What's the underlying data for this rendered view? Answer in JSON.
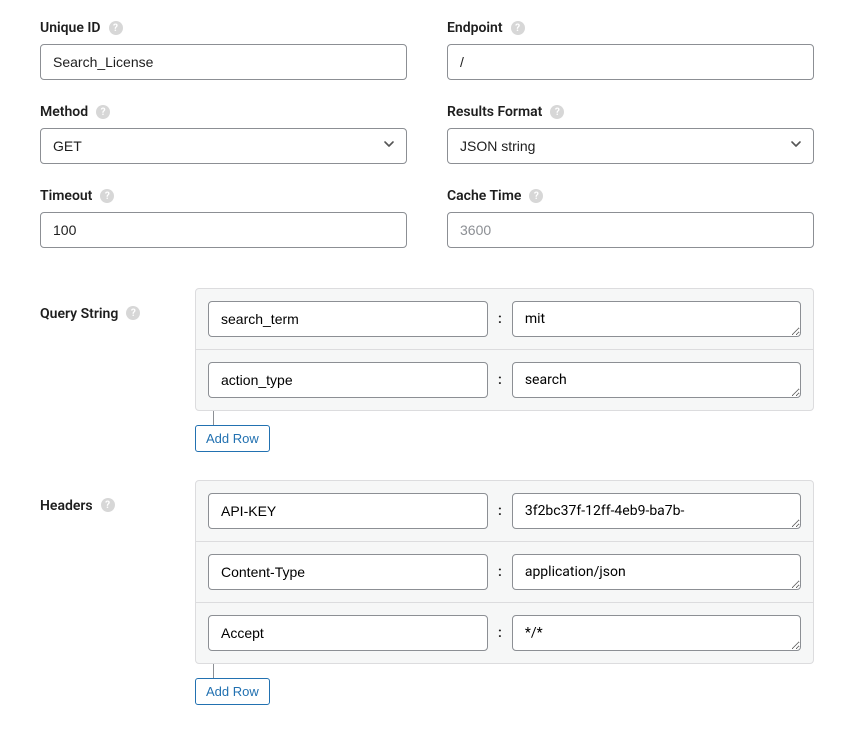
{
  "fields": {
    "unique_id": {
      "label": "Unique ID",
      "value": "Search_License"
    },
    "endpoint": {
      "label": "Endpoint",
      "value": "/"
    },
    "method": {
      "label": "Method",
      "value": "GET"
    },
    "results_format": {
      "label": "Results Format",
      "value": "JSON string"
    },
    "timeout": {
      "label": "Timeout",
      "value": "100"
    },
    "cache_time": {
      "label": "Cache Time",
      "value": "",
      "placeholder": "3600"
    }
  },
  "query_string": {
    "label": "Query String",
    "rows": [
      {
        "key": "search_term",
        "value": "mit"
      },
      {
        "key": "action_type",
        "value": "search"
      }
    ],
    "add_row_label": "Add Row"
  },
  "headers": {
    "label": "Headers",
    "rows": [
      {
        "key": "API-KEY",
        "value": "3f2bc37f-12ff-4eb9-ba7b-"
      },
      {
        "key": "Content-Type",
        "value": "application/json"
      },
      {
        "key": "Accept",
        "value": "*/*"
      }
    ],
    "add_row_label": "Add Row"
  },
  "help_glyph": "?",
  "colon": ":"
}
